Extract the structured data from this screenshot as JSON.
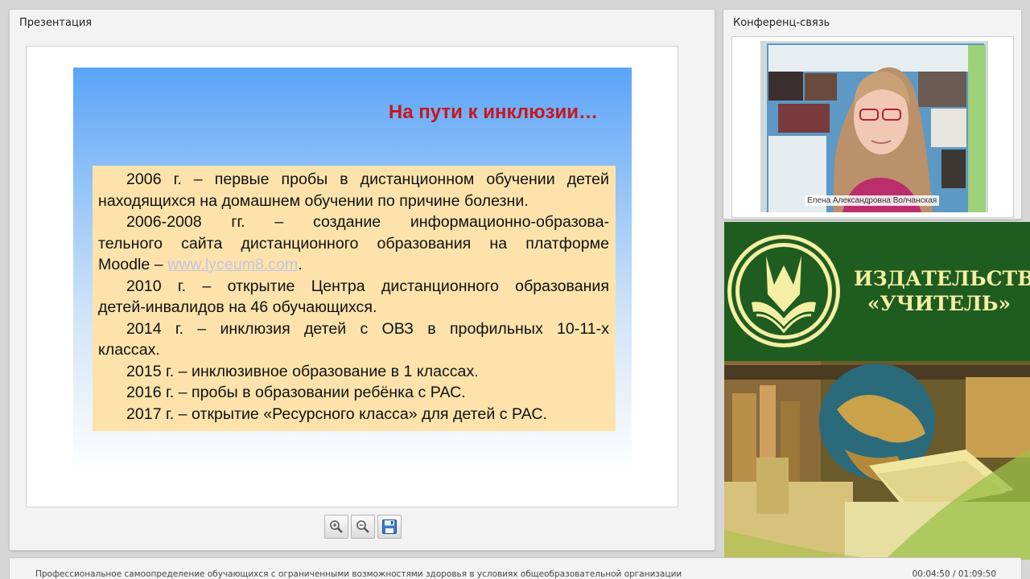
{
  "presentation": {
    "panel_title": "Презентация",
    "slide": {
      "title": "На пути к инклюзии…",
      "lines": [
        "2006 г. – первые пробы в дистанционном обучении детей",
        "находящихся на домашнем обучении по причине болезни.",
        "2006-2008 гг. – создание информационно-образова-",
        "тельного сайта дистанционного образования на платформе",
        "Moodle – ",
        "www.lyceum8.com",
        ".",
        "2010 г. – открытие Центра дистанционного образования",
        "детей-инвалидов на 46 обучающихся.",
        "2014 г. – инклюзия детей с ОВЗ в профильных 10-11-х",
        "классах.",
        "2015 г. – инклюзивное образование в 1 классах.",
        "2016 г. – пробы в образовании ребёнка с РАС.",
        "2017 г. – открытие «Ресурсного класса» для детей с РАС."
      ]
    },
    "toolbar": {
      "zoom_in_icon": "zoom-in-icon",
      "zoom_out_icon": "zoom-out-icon",
      "save_icon": "floppy-disk-icon"
    }
  },
  "conference": {
    "panel_title": "Конференц-связь",
    "speaker_name": "Елена Александровна Волчанская"
  },
  "banner": {
    "brand_line1": "ИЗДАТЕЛЬСТВО",
    "brand_line2": "«УЧИТЕЛЬ»",
    "accent_color": "#f4efa4",
    "background_color": "#1f5c1f"
  },
  "footer": {
    "webinar_title": "Профессиональное самоопределение обучающихся с ограниченными возможностями здоровья в условиях общеобразовательной организации",
    "time": "00:04:50 / 01:09:50"
  },
  "colors": {
    "slide_title": "#c8161d",
    "slide_box": "#fde3ab",
    "slide_gradient_top": "#5aa4f8"
  }
}
